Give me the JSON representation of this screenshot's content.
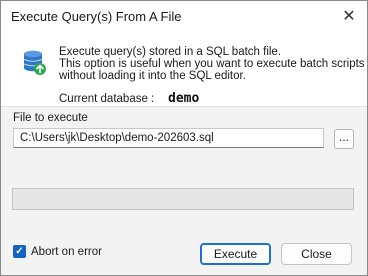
{
  "window": {
    "title": "Execute Query(s) From A File",
    "close_glyph": "✕"
  },
  "info": {
    "icon": "database-import-icon",
    "line1": "Execute query(s) stored in a SQL batch file.",
    "line2": "This option is useful when you want to execute batch scripts",
    "line3": "without loading it into the SQL editor.",
    "current_db_label": "Current database :",
    "current_db_value": "demo"
  },
  "file": {
    "label": "File to execute",
    "value": "C:\\Users\\jk\\Desktop\\demo-202603.sql",
    "browse_label": "..."
  },
  "progress": {
    "fraction": 0
  },
  "options": {
    "abort_label": "Abort on error",
    "abort_checked": true
  },
  "buttons": {
    "execute": "Execute",
    "close": "Close"
  },
  "colors": {
    "accent": "#1463c4",
    "progress": "#06b025",
    "db_icon": "#2f78c8",
    "db_badge": "#2fa84f"
  }
}
